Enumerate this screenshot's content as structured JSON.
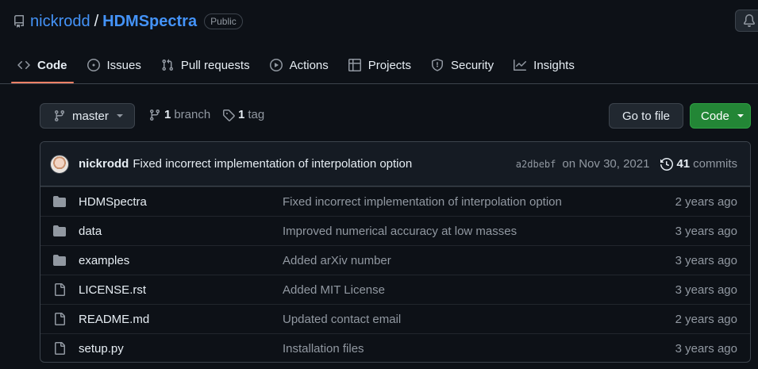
{
  "repo": {
    "owner": "nickrodd",
    "separator": "/",
    "name": "HDMSpectra",
    "visibility": "Public"
  },
  "tabs": [
    {
      "label": "Code",
      "icon": "code-icon",
      "active": true
    },
    {
      "label": "Issues",
      "icon": "issue-icon"
    },
    {
      "label": "Pull requests",
      "icon": "pull-request-icon"
    },
    {
      "label": "Actions",
      "icon": "play-icon"
    },
    {
      "label": "Projects",
      "icon": "table-icon"
    },
    {
      "label": "Security",
      "icon": "shield-icon"
    },
    {
      "label": "Insights",
      "icon": "graph-icon"
    }
  ],
  "toolbar": {
    "branch": "master",
    "branch_count": "1",
    "branch_label": "branch",
    "tag_count": "1",
    "tag_label": "tag",
    "go_to_file": "Go to file",
    "code": "Code"
  },
  "latest_commit": {
    "author": "nickrodd",
    "message": "Fixed incorrect implementation of interpolation option",
    "sha": "a2dbebf",
    "date": "on Nov 30, 2021",
    "count": "41",
    "count_label": "commits"
  },
  "files": [
    {
      "type": "dir",
      "name": "HDMSpectra",
      "message": "Fixed incorrect implementation of interpolation option",
      "age": "2 years ago"
    },
    {
      "type": "dir",
      "name": "data",
      "message": "Improved numerical accuracy at low masses",
      "age": "3 years ago"
    },
    {
      "type": "dir",
      "name": "examples",
      "message": "Added arXiv number",
      "age": "3 years ago"
    },
    {
      "type": "file",
      "name": "LICENSE.rst",
      "message": "Added MIT License",
      "age": "3 years ago"
    },
    {
      "type": "file",
      "name": "README.md",
      "message": "Updated contact email",
      "age": "2 years ago"
    },
    {
      "type": "file",
      "name": "setup.py",
      "message": "Installation files",
      "age": "3 years ago"
    }
  ],
  "colors": {
    "background": "#0d1117",
    "link": "#4493f8",
    "primary_button": "#238636",
    "active_tab_underline": "#f78166"
  }
}
